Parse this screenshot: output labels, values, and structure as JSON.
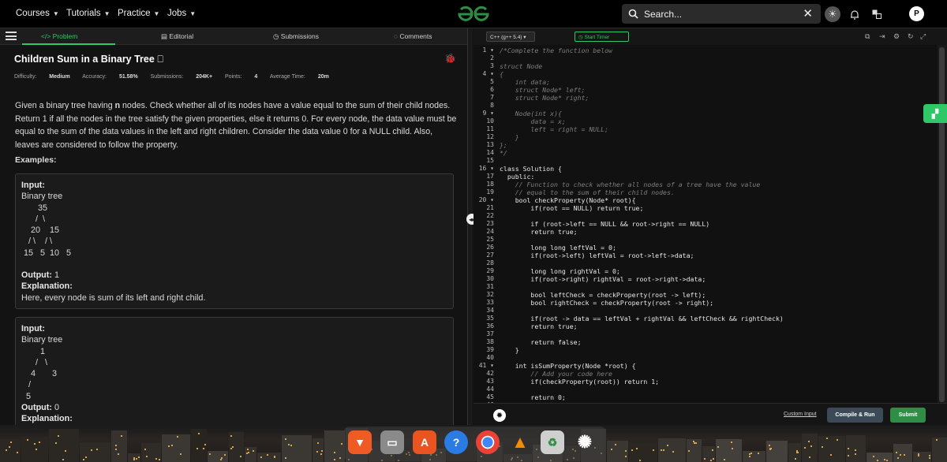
{
  "nav": {
    "items": [
      "Courses",
      "Tutorials",
      "Practice",
      "Jobs"
    ],
    "search_placeholder": "Search...",
    "avatar_initial": "P"
  },
  "tabs": [
    "Problem",
    "Editorial",
    "Submissions",
    "Comments"
  ],
  "problem": {
    "title": "Children Sum in a Binary Tree",
    "difficulty_label": "Difficulty:",
    "difficulty": "Medium",
    "accuracy_label": "Accuracy:",
    "accuracy": "51.58%",
    "submissions_label": "Submissions:",
    "submissions": "204K+",
    "points_label": "Points:",
    "points": "4",
    "avg_time_label": "Average Time:",
    "avg_time": "20m",
    "description_pre": "Given a binary tree having ",
    "description_bold": "n",
    "description_post": " nodes. Check whether all of its nodes have a value equal to the sum of their child nodes. Return 1 if all the nodes in the tree satisfy the given properties, else it returns 0. For every node, the data value must be equal to the sum of the data values in the left and right children. Consider the data value 0 for a NULL child. Also, leaves are considered to follow the property.",
    "examples_title": "Examples:",
    "examples": [
      {
        "input_label": "Input:",
        "input": "Binary tree\n       35\n      /  \\\n    20    15\n   / \\    / \\\n 15   5  10   5",
        "output_label": "Output:",
        "output": "1",
        "explanation_label": "Explanation:",
        "explanation": "Here, every node is sum of its left and right child."
      },
      {
        "input_label": "Input:",
        "input": "Binary tree\n        1\n      /   \\\n    4       3\n   /\n  5",
        "output_label": "Output:",
        "output": "0",
        "explanation_label": "Explanation:"
      }
    ]
  },
  "editor": {
    "language": "C++ (g++ 5.4)",
    "timer": "Start Timer",
    "custom_input": "Custom Input",
    "compile_run": "Compile & Run",
    "submit": "Submit",
    "lines": [
      "/*Complete the function below",
      "",
      "struct Node",
      "{",
      "    int data;",
      "    struct Node* left;",
      "    struct Node* right;",
      "",
      "    Node(int x){",
      "        data = x;",
      "        left = right = NULL;",
      "    }",
      "};",
      "*/",
      "",
      "class Solution {",
      "  public:",
      "    // Function to check whether all nodes of a tree have the value",
      "    // equal to the sum of their child nodes.",
      "    bool checkProperty(Node* root){",
      "        if(root == NULL) return true;",
      "",
      "        if (root->left == NULL && root->right == NULL)",
      "        return true;",
      "",
      "        long long leftVal = 0;",
      "        if(root->left) leftVal = root->left->data;",
      "",
      "        long long rightVal = 0;",
      "        if(root->right) rightVal = root->right->data;",
      "",
      "        bool leftCheck = checkProperty(root -> left);",
      "        bool rightCheck = checkProperty(root -> right);",
      "",
      "        if(root -> data == leftVal + rightVal && leftCheck && rightCheck)",
      "        return true;",
      "",
      "        return false;",
      "    }",
      "",
      "    int isSumProperty(Node *root) {",
      "        // Add your code here",
      "        if(checkProperty(root)) return 1;",
      "",
      "        return 0;",
      "    }"
    ],
    "comment_lines": [
      1,
      2,
      3,
      4,
      5,
      6,
      7,
      8,
      9,
      10,
      11,
      12,
      13,
      14,
      18,
      19,
      42
    ]
  }
}
